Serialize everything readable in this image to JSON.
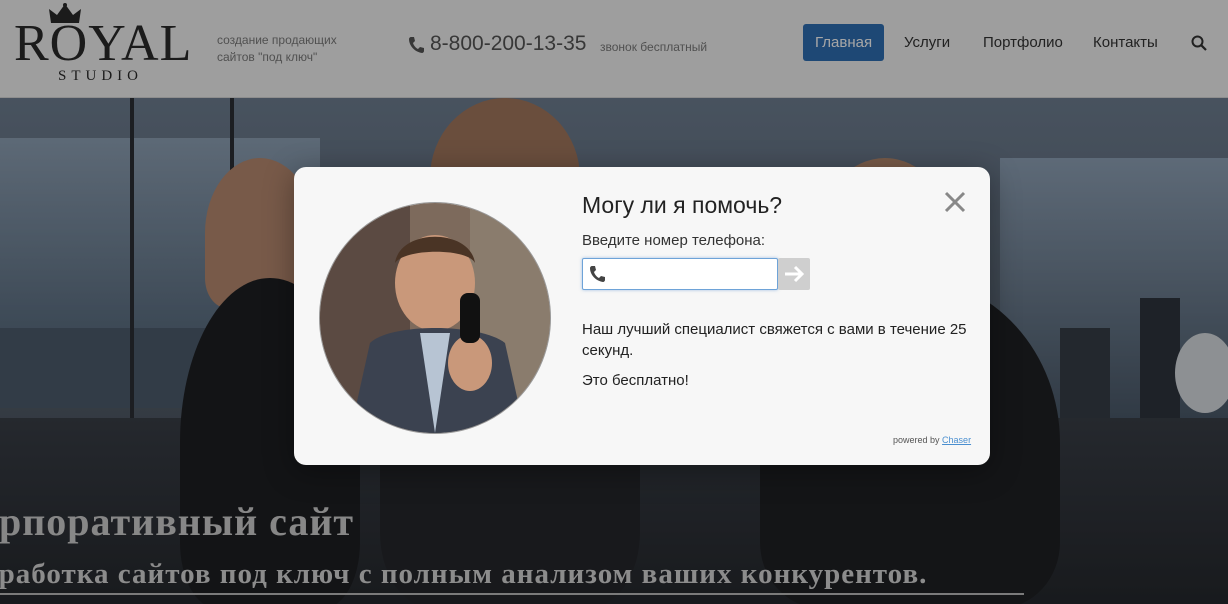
{
  "header": {
    "logo_main": "ROYAL",
    "logo_sub": "STUDIO",
    "tagline": "создание продающих сайтов \"под ключ\"",
    "phone": "8-800-200-13-35",
    "phone_note": "звонок бесплатный"
  },
  "nav": {
    "items": [
      {
        "label": "Главная"
      },
      {
        "label": "Услуги"
      },
      {
        "label": "Портфолио"
      },
      {
        "label": "Контакты"
      }
    ]
  },
  "hero": {
    "title": "орпоративный сайт",
    "subtitle": "зработка сайтов под ключ с полным анализом ваших конкурентов."
  },
  "modal": {
    "title": "Могу ли я помочь?",
    "label": "Введите номер телефона:",
    "phone_value": "",
    "phone_placeholder": "",
    "text": "Наш лучший специалист свяжется с вами в течение 25 секунд.",
    "free": "Это бесплатно!",
    "powered_prefix": "powered by",
    "powered_link": "Chaser"
  },
  "colors": {
    "nav_active": "#2f6fb4",
    "modal_bg": "#f7f7f7",
    "link": "#4a8fd0"
  }
}
